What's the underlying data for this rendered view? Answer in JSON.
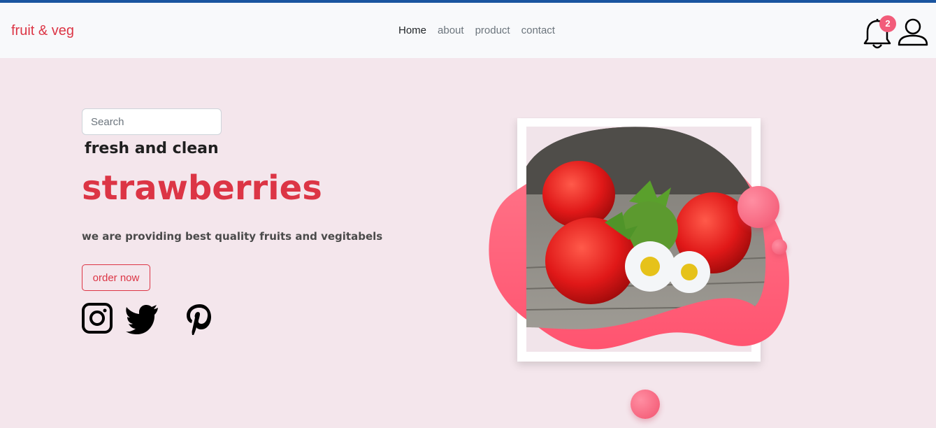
{
  "navbar": {
    "brand": "fruit & veg",
    "links": [
      {
        "label": "Home",
        "active": true
      },
      {
        "label": "about",
        "active": false
      },
      {
        "label": "product",
        "active": false
      },
      {
        "label": "contact",
        "active": false
      }
    ],
    "notification_count": "2",
    "icons": [
      "bell-icon",
      "user-icon"
    ]
  },
  "hero": {
    "search_placeholder": "Search",
    "subtitle": "fresh and clean",
    "title": "strawberries",
    "tagline": "we are providing best quality fruits and vegitabels",
    "order_button": "order now",
    "social_icons": [
      "instagram-icon",
      "twitter-icon",
      "pinterest-icon"
    ]
  },
  "colors": {
    "brand": "#dc3545",
    "top_line": "#1a55a0",
    "background": "#f4e6ec",
    "blob": "#ff5c78"
  }
}
